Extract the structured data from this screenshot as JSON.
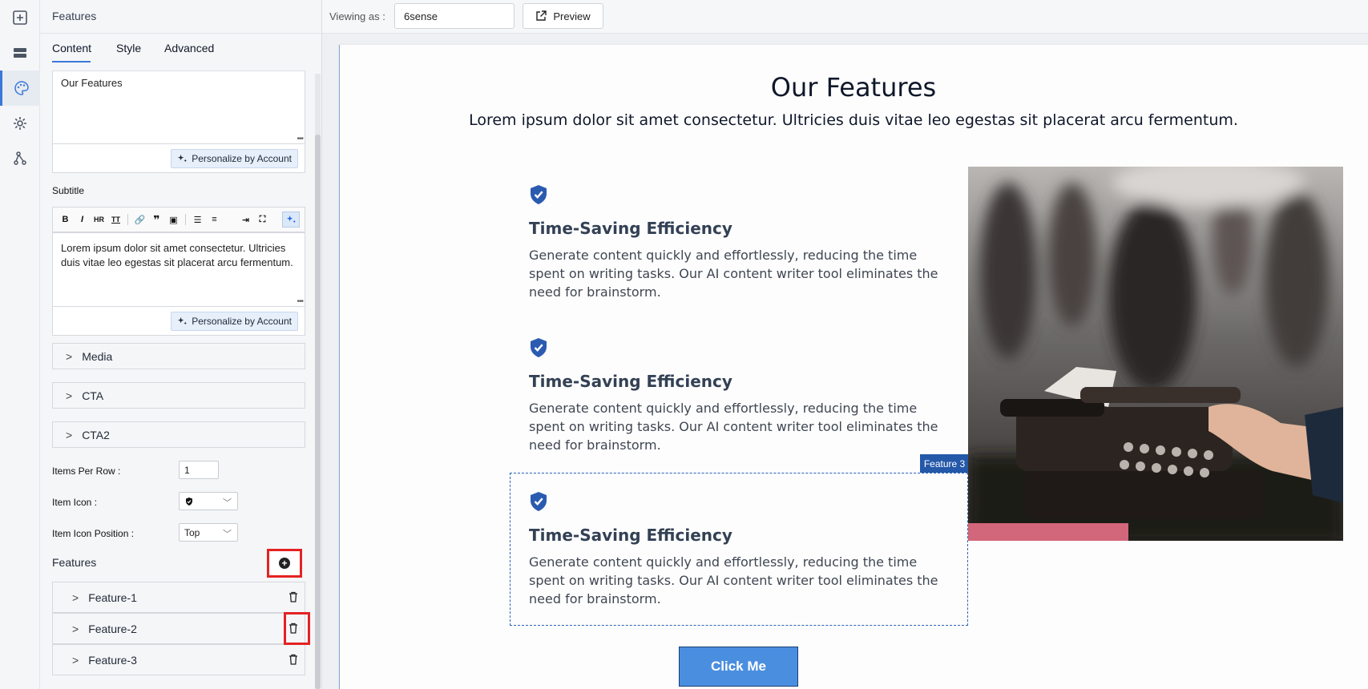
{
  "panel": {
    "title": "Features",
    "tabs": [
      "Content",
      "Style",
      "Advanced"
    ],
    "title_text": "Our Features",
    "personalize_label": "Personalize by Account",
    "subtitle_label": "Subtitle",
    "subtitle_text": "Lorem ipsum dolor sit amet consectetur. Ultricies duis vitae leo egestas sit placerat arcu fermentum.",
    "accordions": [
      "Media",
      "CTA",
      "CTA2"
    ],
    "items_per_row_label": "Items Per Row :",
    "items_per_row_value": "1",
    "item_icon_label": "Item Icon :",
    "item_icon_position_label": "Item Icon Position :",
    "item_icon_position_value": "Top",
    "features_label": "Features",
    "feature_items": [
      "Feature-1",
      "Feature-2",
      "Feature-3"
    ]
  },
  "topbar": {
    "viewing_label": "Viewing as :",
    "viewing_value": "6sense",
    "preview_label": "Preview"
  },
  "canvas": {
    "title": "Our Features",
    "subtitle": "Lorem ipsum dolor sit amet consectetur. Ultricies duis vitae leo egestas sit placerat arcu fermentum.",
    "features": [
      {
        "title": "Time-Saving Efficiency",
        "desc": "Generate content quickly and effortlessly, reducing the time spent on writing tasks. Our AI content writer tool eliminates the need for brainstorm."
      },
      {
        "title": "Time-Saving Efficiency",
        "desc": "Generate content quickly and effortlessly, reducing the time spent on writing tasks. Our AI content writer tool eliminates the need for brainstorm."
      },
      {
        "title": "Time-Saving Efficiency",
        "desc": "Generate content quickly and effortlessly, reducing the time spent on writing tasks. Our AI content writer tool eliminates the need for brainstorm."
      }
    ],
    "selected_tag": "Feature 3",
    "cta_label": "Click Me"
  },
  "colors": {
    "accent": "#3b78d8",
    "shield": "#2a5bb0",
    "cta": "#4a8ee0",
    "highlight": "#e52222"
  }
}
